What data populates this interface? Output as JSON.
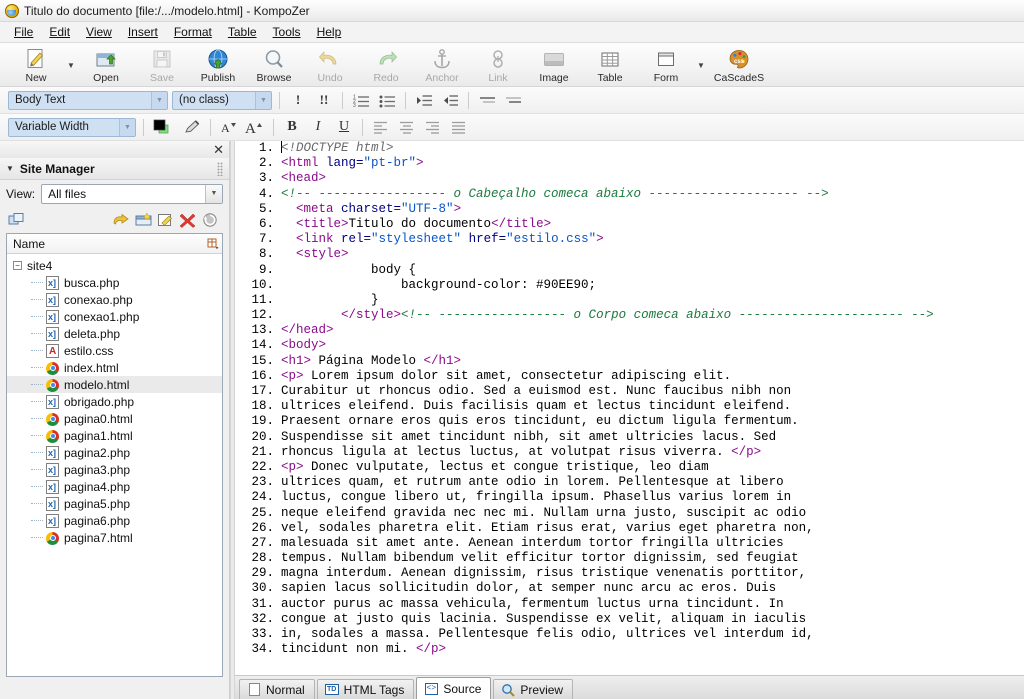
{
  "window": {
    "title": "Titulo do documento [file:/.../modelo.html] - KompoZer",
    "icon": "kompozer-icon"
  },
  "menubar": [
    {
      "label": "File",
      "accel": "F"
    },
    {
      "label": "Edit",
      "accel": "E"
    },
    {
      "label": "View",
      "accel": "V"
    },
    {
      "label": "Insert",
      "accel": "I"
    },
    {
      "label": "Format",
      "accel": "o"
    },
    {
      "label": "Table",
      "accel": "b"
    },
    {
      "label": "Tools",
      "accel": "T"
    },
    {
      "label": "Help",
      "accel": "H"
    }
  ],
  "toolbar": {
    "buttons": [
      {
        "label": "New",
        "icon": "new-document-icon",
        "disabled": false
      },
      {
        "label": "Open",
        "icon": "open-folder-icon",
        "disabled": false
      },
      {
        "label": "Save",
        "icon": "floppy-save-icon",
        "disabled": true
      },
      {
        "label": "Publish",
        "icon": "publish-globe-icon",
        "disabled": false
      },
      {
        "label": "Browse",
        "icon": "browse-magnifier-icon",
        "disabled": false
      },
      {
        "label": "Undo",
        "icon": "undo-arrow-icon",
        "disabled": true
      },
      {
        "label": "Redo",
        "icon": "redo-arrow-icon",
        "disabled": true
      },
      {
        "label": "Anchor",
        "icon": "anchor-icon",
        "disabled": true
      },
      {
        "label": "Link",
        "icon": "link-chain-icon",
        "disabled": true
      },
      {
        "label": "Image",
        "icon": "image-icon",
        "disabled": false
      },
      {
        "label": "Table",
        "icon": "table-grid-icon",
        "disabled": false
      },
      {
        "label": "Form",
        "icon": "form-window-icon",
        "disabled": false
      },
      {
        "label": "CaScadeS",
        "icon": "cascades-palette-icon",
        "disabled": false
      }
    ]
  },
  "formatbar": {
    "paragraph_style": "Body Text",
    "class_select": "(no class)",
    "font_select": "Variable Width",
    "buttons": [
      {
        "name": "decrease-emphasis",
        "glyph": "!"
      },
      {
        "name": "increase-emphasis",
        "glyph": "!!"
      },
      {
        "name": "numbered-list",
        "glyph": "ol"
      },
      {
        "name": "bulleted-list",
        "glyph": "ul"
      },
      {
        "name": "indent",
        "glyph": "indent"
      },
      {
        "name": "outdent",
        "glyph": "outdent"
      },
      {
        "name": "definition-term",
        "glyph": "dt"
      },
      {
        "name": "definition-description",
        "glyph": "dd"
      },
      {
        "name": "text-color",
        "glyph": "swatch"
      },
      {
        "name": "highlight-color",
        "glyph": "pen"
      },
      {
        "name": "decrease-font-size",
        "glyph": "A-"
      },
      {
        "name": "increase-font-size",
        "glyph": "A+"
      },
      {
        "name": "bold",
        "glyph": "B"
      },
      {
        "name": "italic",
        "glyph": "I"
      },
      {
        "name": "underline",
        "glyph": "U"
      },
      {
        "name": "align-left",
        "glyph": "left"
      },
      {
        "name": "align-center",
        "glyph": "center"
      },
      {
        "name": "align-right",
        "glyph": "right"
      },
      {
        "name": "align-justify",
        "glyph": "justify"
      }
    ]
  },
  "site_manager": {
    "panel_title": "Site Manager",
    "close_label": "✕",
    "view_label": "View:",
    "view_value": "All files",
    "column_header": "Name",
    "tools": [
      {
        "name": "edit-sites-icon"
      },
      {
        "name": "open-file-icon"
      },
      {
        "name": "new-folder-icon"
      },
      {
        "name": "rename-file-icon"
      },
      {
        "name": "delete-file-icon"
      },
      {
        "name": "refresh-icon"
      }
    ],
    "root": "site4",
    "files": [
      {
        "name": "busca.php",
        "type": "php",
        "selected": false
      },
      {
        "name": "conexao.php",
        "type": "php",
        "selected": false
      },
      {
        "name": "conexao1.php",
        "type": "php",
        "selected": false
      },
      {
        "name": "deleta.php",
        "type": "php",
        "selected": false
      },
      {
        "name": "estilo.css",
        "type": "css",
        "selected": false
      },
      {
        "name": "index.html",
        "type": "html",
        "selected": false
      },
      {
        "name": "modelo.html",
        "type": "html",
        "selected": true
      },
      {
        "name": "obrigado.php",
        "type": "php",
        "selected": false
      },
      {
        "name": "pagina0.html",
        "type": "html",
        "selected": false
      },
      {
        "name": "pagina1.html",
        "type": "html",
        "selected": false
      },
      {
        "name": "pagina2.php",
        "type": "php",
        "selected": false
      },
      {
        "name": "pagina3.php",
        "type": "php",
        "selected": false
      },
      {
        "name": "pagina4.php",
        "type": "php",
        "selected": false
      },
      {
        "name": "pagina5.php",
        "type": "php",
        "selected": false
      },
      {
        "name": "pagina6.php",
        "type": "php",
        "selected": false
      },
      {
        "name": "pagina7.html",
        "type": "html",
        "selected": false
      }
    ]
  },
  "view_tabs": [
    {
      "label": "Normal",
      "icon": "page-icon",
      "active": false
    },
    {
      "label": "HTML Tags",
      "icon": "html-tags-icon",
      "active": false
    },
    {
      "label": "Source",
      "icon": "source-code-icon",
      "active": true
    },
    {
      "label": "Preview",
      "icon": "preview-magnifier-icon",
      "active": false
    }
  ],
  "source": {
    "language": "html",
    "lines": [
      {
        "n": 1,
        "tokens": [
          {
            "t": "caret",
            "v": ""
          },
          {
            "t": "doctype",
            "v": "<!DOCTYPE html>"
          }
        ]
      },
      {
        "n": 2,
        "tokens": [
          {
            "t": "tg",
            "v": "<html "
          },
          {
            "t": "at",
            "v": "lang="
          },
          {
            "t": "av",
            "v": "\"pt-br\""
          },
          {
            "t": "tg",
            "v": ">"
          }
        ]
      },
      {
        "n": 3,
        "tokens": [
          {
            "t": "tg",
            "v": "<head>"
          }
        ]
      },
      {
        "n": 4,
        "tokens": [
          {
            "t": "cm",
            "v": "<!-- ----------------- o Cabeçalho comeca abaixo -------------------- -->"
          }
        ]
      },
      {
        "n": 5,
        "tokens": [
          {
            "t": "tx",
            "v": "  "
          },
          {
            "t": "tg",
            "v": "<meta "
          },
          {
            "t": "at",
            "v": "charset="
          },
          {
            "t": "av",
            "v": "\"UTF-8\""
          },
          {
            "t": "tg",
            "v": ">"
          }
        ]
      },
      {
        "n": 6,
        "tokens": [
          {
            "t": "tx",
            "v": "  "
          },
          {
            "t": "tg",
            "v": "<title>"
          },
          {
            "t": "tx",
            "v": "Titulo do documento"
          },
          {
            "t": "tg",
            "v": "</title>"
          }
        ]
      },
      {
        "n": 7,
        "tokens": [
          {
            "t": "tx",
            "v": "  "
          },
          {
            "t": "tg",
            "v": "<link "
          },
          {
            "t": "at",
            "v": "rel="
          },
          {
            "t": "av",
            "v": "\"stylesheet\" "
          },
          {
            "t": "at",
            "v": "href="
          },
          {
            "t": "av",
            "v": "\"estilo.css\""
          },
          {
            "t": "tg",
            "v": ">"
          }
        ]
      },
      {
        "n": 8,
        "tokens": [
          {
            "t": "tx",
            "v": "  "
          },
          {
            "t": "tg",
            "v": "<style>"
          }
        ]
      },
      {
        "n": 9,
        "tokens": [
          {
            "t": "tx",
            "v": "            body {"
          }
        ]
      },
      {
        "n": 10,
        "tokens": [
          {
            "t": "tx",
            "v": "                background-color: #90EE90;"
          }
        ]
      },
      {
        "n": 11,
        "tokens": [
          {
            "t": "tx",
            "v": "            }"
          }
        ]
      },
      {
        "n": 12,
        "tokens": [
          {
            "t": "tx",
            "v": "        "
          },
          {
            "t": "tg",
            "v": "</style>"
          },
          {
            "t": "cm",
            "v": "<!-- ----------------- o Corpo comeca abaixo ---------------------- -->"
          }
        ]
      },
      {
        "n": 13,
        "tokens": [
          {
            "t": "tg",
            "v": "</head>"
          }
        ]
      },
      {
        "n": 14,
        "tokens": [
          {
            "t": "tg",
            "v": "<body>"
          }
        ]
      },
      {
        "n": 15,
        "tokens": [
          {
            "t": "tg",
            "v": "<h1>"
          },
          {
            "t": "tx",
            "v": " Página Modelo "
          },
          {
            "t": "tg",
            "v": "</h1>"
          }
        ]
      },
      {
        "n": 16,
        "tokens": [
          {
            "t": "tg",
            "v": "<p>"
          },
          {
            "t": "tx",
            "v": " Lorem ipsum dolor sit amet, consectetur adipiscing elit."
          }
        ]
      },
      {
        "n": 17,
        "tokens": [
          {
            "t": "tx",
            "v": "Curabitur ut rhoncus odio. Sed a euismod est. Nunc faucibus nibh non"
          }
        ]
      },
      {
        "n": 18,
        "tokens": [
          {
            "t": "tx",
            "v": "ultrices eleifend. Duis facilisis quam et lectus tincidunt eleifend."
          }
        ]
      },
      {
        "n": 19,
        "tokens": [
          {
            "t": "tx",
            "v": "Praesent ornare eros quis eros tincidunt, eu dictum ligula fermentum."
          }
        ]
      },
      {
        "n": 20,
        "tokens": [
          {
            "t": "tx",
            "v": "Suspendisse sit amet tincidunt nibh, sit amet ultricies lacus. Sed"
          }
        ]
      },
      {
        "n": 21,
        "tokens": [
          {
            "t": "tx",
            "v": "rhoncus ligula at lectus luctus, at volutpat risus viverra. "
          },
          {
            "t": "tg",
            "v": "</p>"
          }
        ]
      },
      {
        "n": 22,
        "tokens": [
          {
            "t": "tg",
            "v": "<p>"
          },
          {
            "t": "tx",
            "v": " Donec vulputate, lectus et congue tristique, leo diam"
          }
        ]
      },
      {
        "n": 23,
        "tokens": [
          {
            "t": "tx",
            "v": "ultrices quam, et rutrum ante odio in lorem. Pellentesque at libero"
          }
        ]
      },
      {
        "n": 24,
        "tokens": [
          {
            "t": "tx",
            "v": "luctus, congue libero ut, fringilla ipsum. Phasellus varius lorem in"
          }
        ]
      },
      {
        "n": 25,
        "tokens": [
          {
            "t": "tx",
            "v": "neque eleifend gravida nec nec mi. Nullam urna justo, suscipit ac odio"
          }
        ]
      },
      {
        "n": 26,
        "tokens": [
          {
            "t": "tx",
            "v": "vel, sodales pharetra elit. Etiam risus erat, varius eget pharetra non,"
          }
        ]
      },
      {
        "n": 27,
        "tokens": [
          {
            "t": "tx",
            "v": "malesuada sit amet ante. Aenean interdum tortor fringilla ultricies"
          }
        ]
      },
      {
        "n": 28,
        "tokens": [
          {
            "t": "tx",
            "v": "tempus. Nullam bibendum velit efficitur tortor dignissim, sed feugiat"
          }
        ]
      },
      {
        "n": 29,
        "tokens": [
          {
            "t": "tx",
            "v": "magna interdum. Aenean dignissim, risus tristique venenatis porttitor,"
          }
        ]
      },
      {
        "n": 30,
        "tokens": [
          {
            "t": "tx",
            "v": "sapien lacus sollicitudin dolor, at semper nunc arcu ac eros. Duis"
          }
        ]
      },
      {
        "n": 31,
        "tokens": [
          {
            "t": "tx",
            "v": "auctor purus ac massa vehicula, fermentum luctus urna tincidunt. In"
          }
        ]
      },
      {
        "n": 32,
        "tokens": [
          {
            "t": "tx",
            "v": "congue at justo quis lacinia. Suspendisse ex velit, aliquam in iaculis"
          }
        ]
      },
      {
        "n": 33,
        "tokens": [
          {
            "t": "tx",
            "v": "in, sodales a massa. Pellentesque felis odio, ultrices vel interdum id,"
          }
        ]
      },
      {
        "n": 34,
        "tokens": [
          {
            "t": "tx",
            "v": "tincidunt non mi. "
          },
          {
            "t": "tg",
            "v": "</p>"
          }
        ]
      }
    ]
  },
  "colors": {
    "tag": "#8b0a8b",
    "attribute": "#000080",
    "attribute_value": "#0a55c8",
    "comment": "#1a7a3c",
    "text": "#000000",
    "doctype": "#6a6a6a",
    "combo_bg": "#cfe0f2",
    "selection_row": "#eaeaea",
    "page_bg_css_value": "#90EE90"
  }
}
